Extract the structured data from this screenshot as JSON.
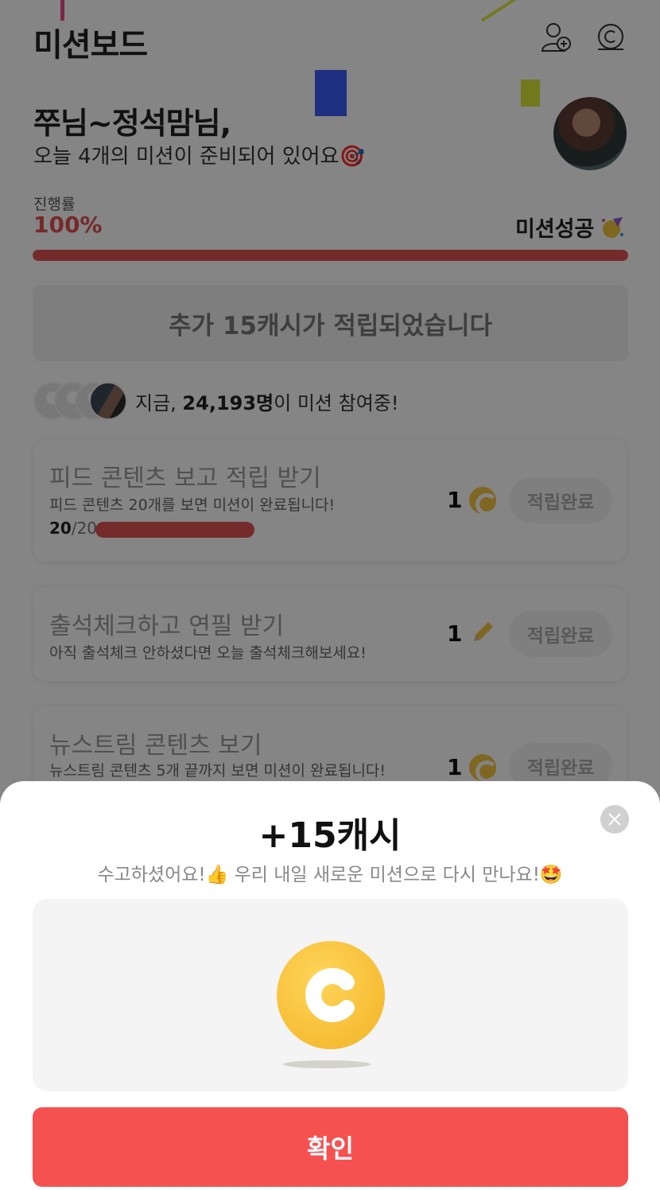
{
  "header": {
    "title": "미션보드"
  },
  "greeting": {
    "name": "쭈님~정석맘님,",
    "subtitle": "오늘 4개의 미션이 준비되어 있어요"
  },
  "progress": {
    "label": "진행률",
    "value": "100%",
    "status": "미션성공",
    "fraction": 1.0
  },
  "bonus_banner": "추가 15캐시가 적립되었습니다",
  "participants": {
    "prefix": "지금, ",
    "count": "24,193명",
    "suffix": "이 미션 참여중!"
  },
  "missions": [
    {
      "title": "피드 콘텐츠 보고 적립 받기",
      "desc": "피드 콘텐츠 20개를 보면 미션이 완료됩니다!",
      "reward_count": "1",
      "reward_icon": "cash-coin-icon",
      "button": "적립완료",
      "progress_done": "20",
      "progress_total": "/20",
      "progress_fraction": 1.0
    },
    {
      "title": "출석체크하고 연필 받기",
      "desc": "아직 출석체크 안하셨다면 오늘 출석체크해보세요!",
      "reward_count": "1",
      "reward_icon": "pencil-icon",
      "button": "적립완료"
    },
    {
      "title": "뉴스트림 콘텐츠 보기",
      "desc": "뉴스트림 콘텐츠 5개 끝까지 보면 미션이 완료됩니다!",
      "reward_count": "1",
      "reward_icon": "cash-coin-icon",
      "button": "적립완료"
    }
  ],
  "modal": {
    "title": "+15캐시",
    "subtitle_part1": "수고하셨어요!",
    "subtitle_part2": " 우리 내일 새로운 미션으로 다시 만나요!",
    "confirm": "확인"
  },
  "colors": {
    "accent_red": "#f55150",
    "progress_red": "#e05454",
    "coin_yellow": "#f4c542"
  }
}
